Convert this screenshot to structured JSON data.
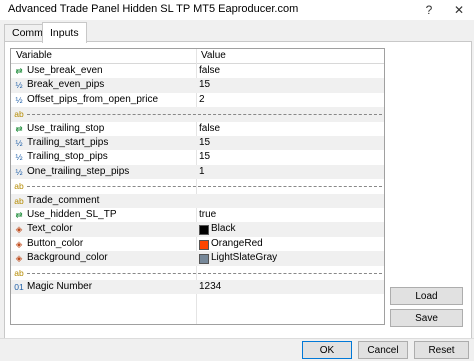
{
  "window": {
    "title": "Advanced Trade Panel Hidden SL TP MT5 Eaproducer.com",
    "help_glyph": "?",
    "close_glyph": "✕"
  },
  "tabs": [
    {
      "label": "Common",
      "active": false
    },
    {
      "label": "Inputs",
      "active": true
    }
  ],
  "table": {
    "col_variable": "Variable",
    "col_value": "Value",
    "rows": [
      {
        "icon": "bool-icon",
        "glyph": "⇄",
        "color": "#1e8c3a",
        "name": "Use_break_even",
        "value": "false"
      },
      {
        "icon": "int-icon",
        "glyph": "½",
        "color": "#1f5fa8",
        "name": "Break_even_pips",
        "value": "15"
      },
      {
        "icon": "int-icon",
        "glyph": "½",
        "color": "#1f5fa8",
        "name": "Offset_pips_from_open_price",
        "value": "2"
      },
      {
        "icon": "string-icon",
        "glyph": "ab",
        "color": "#b58b00",
        "name": "",
        "value": "",
        "separator": true
      },
      {
        "icon": "bool-icon",
        "glyph": "⇄",
        "color": "#1e8c3a",
        "name": "Use_trailing_stop",
        "value": "false"
      },
      {
        "icon": "int-icon",
        "glyph": "½",
        "color": "#1f5fa8",
        "name": "Trailing_start_pips",
        "value": "15"
      },
      {
        "icon": "int-icon",
        "glyph": "½",
        "color": "#1f5fa8",
        "name": "Trailing_stop_pips",
        "value": "15"
      },
      {
        "icon": "int-icon",
        "glyph": "½",
        "color": "#1f5fa8",
        "name": "One_trailing_step_pips",
        "value": "1"
      },
      {
        "icon": "string-icon",
        "glyph": "ab",
        "color": "#b58b00",
        "name": "",
        "value": "",
        "separator": true
      },
      {
        "icon": "string-icon",
        "glyph": "ab",
        "color": "#b58b00",
        "name": "Trade_comment",
        "value": ""
      },
      {
        "icon": "bool-icon",
        "glyph": "⇄",
        "color": "#1e8c3a",
        "name": "Use_hidden_SL_TP",
        "value": "true"
      },
      {
        "icon": "color-icon",
        "glyph": "◈",
        "color": "#c04a1a",
        "name": "Text_color",
        "value": "Black",
        "swatch": "#000000"
      },
      {
        "icon": "color-icon",
        "glyph": "◈",
        "color": "#c04a1a",
        "name": "Button_color",
        "value": "OrangeRed",
        "swatch": "#ff4500"
      },
      {
        "icon": "color-icon",
        "glyph": "◈",
        "color": "#c04a1a",
        "name": "Background_color",
        "value": "LightSlateGray",
        "swatch": "#778899"
      },
      {
        "icon": "string-icon",
        "glyph": "ab",
        "color": "#b58b00",
        "name": "",
        "value": "",
        "separator": true
      },
      {
        "icon": "number-icon",
        "glyph": "01",
        "color": "#1f5fa8",
        "name": "Magic Number",
        "value": "1234"
      }
    ]
  },
  "buttons": {
    "load": "Load",
    "save": "Save",
    "ok": "OK",
    "cancel": "Cancel",
    "reset": "Reset"
  }
}
